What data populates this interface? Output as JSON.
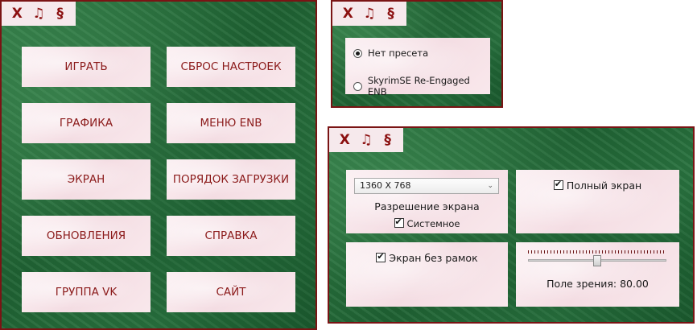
{
  "toolbar": {
    "close_label": "X",
    "music_label": "♫",
    "section_label": "§"
  },
  "main_menu": {
    "buttons": [
      {
        "label": "ИГРАТЬ"
      },
      {
        "label": "СБРОС НАСТРОЕК"
      },
      {
        "label": "ГРАФИКА"
      },
      {
        "label": "МЕНЮ ENB"
      },
      {
        "label": "ЭКРАН"
      },
      {
        "label": "ПОРЯДОК ЗАГРУЗКИ"
      },
      {
        "label": "ОБНОВЛЕНИЯ"
      },
      {
        "label": "СПРАВКА"
      },
      {
        "label": "ГРУППА VK"
      },
      {
        "label": "САЙТ"
      }
    ]
  },
  "preset_panel": {
    "options": [
      {
        "label": "Нет пресета",
        "selected": true
      },
      {
        "label": "SkyrimSE Re-Engaged ENB",
        "selected": false
      }
    ]
  },
  "screen_panel": {
    "resolution": {
      "value": "1360 X 768",
      "label": "Разрешение экрана",
      "system_label": "Системное",
      "system_checked": true
    },
    "fullscreen": {
      "label": "Полный экран",
      "checked": true
    },
    "borderless": {
      "label": "Экран без рамок",
      "checked": true
    },
    "fov": {
      "label": "Поле зрения: 80.00",
      "value_fraction": 0.5
    }
  },
  "colors": {
    "accent": "#8b1010",
    "panel_border": "#7a1414",
    "card_bg": "#f6e4e9",
    "marble_green": "#2a7440"
  }
}
